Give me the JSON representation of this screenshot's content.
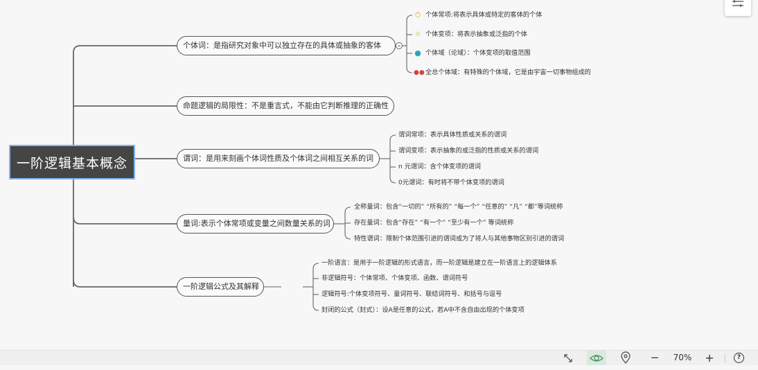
{
  "root": {
    "label": "一阶逻辑基本概念"
  },
  "branches": [
    {
      "label": "个体词：是指研究对象中可以独立存在的具体或抽象的客体",
      "children": [
        {
          "icon": "stopwatch-icon",
          "text": "个体常项:将表示具体或特定的客体的个体"
        },
        {
          "icon": "lightbulb-icon",
          "text": "个体变项：将表示抽象或泛指的个体"
        },
        {
          "icon": "person-icon",
          "text": "个体域（论域）：个体变项的取值范围"
        },
        {
          "icon": "people-icon",
          "text": "全总个体域：有特殊的个体域，它是由宇宙一切事物组成的"
        }
      ]
    },
    {
      "label": "命题逻辑的局限性：不是重言式，不能由它判断推理的正确性",
      "children": []
    },
    {
      "label": "谓词：是用来刻画个体词性质及个体词之间相互关系的词",
      "children": [
        {
          "text": "谓词常项：表示具体性质或关系的谓词"
        },
        {
          "text": "谓词变项：表示抽象的或泛指的性质或关系的谓词"
        },
        {
          "text": "n 元谓词：含个体变项的谓词"
        },
        {
          "text": "0元谓词：有时将不带个体变项的谓词"
        }
      ]
    },
    {
      "label": "量词:表示个体常项或变量之间数量关系的词",
      "children": [
        {
          "text": "全称量词：包含“一切的” “所有的” “每一个” “任意的” “凡” “都”等词统称"
        },
        {
          "text": "存在量词：包含“存在” “有一个” “至少有一个” 等词统称"
        },
        {
          "text": "特性谓词：限制个体范围引进的谓词或为了将人与其他事物区别引进的谓词"
        }
      ]
    },
    {
      "label": "一阶逻辑公式及其解释",
      "children": [
        {
          "text": "一阶语言：是用于一阶逻辑的形式语言，而一阶逻辑是建立在一阶语言上的逻辑体系"
        },
        {
          "text": "非逻辑符号：个体常项、个体变项、函数、谓词符号"
        },
        {
          "text": "逻辑符号:个体变项符号、量词符号、联结词符号、和括号与逗号"
        },
        {
          "text": "封闭的公式（封式）：设A是任意的公式，若A中不含自由出现的个体变项"
        }
      ]
    }
  ],
  "statusbar": {
    "zoom": "70%",
    "minus": "−",
    "plus": "+",
    "help": "?"
  },
  "colors": {
    "root_bg": "#454545",
    "root_border": "#7fb2f0",
    "line": "#666666"
  }
}
